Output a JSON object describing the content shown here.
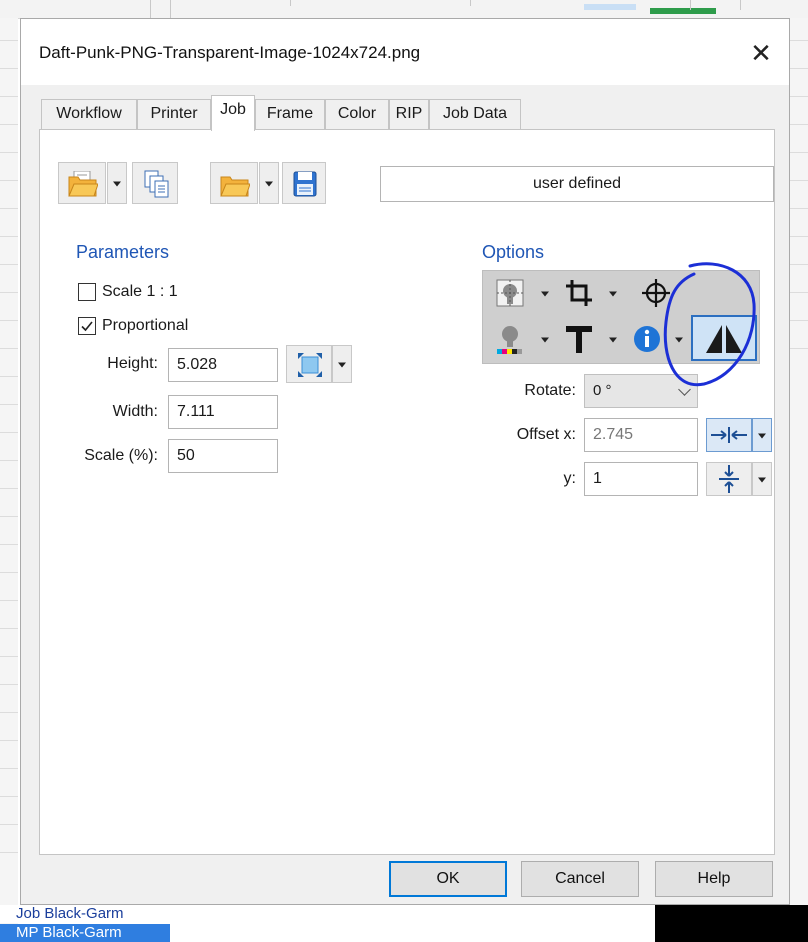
{
  "window": {
    "title": "Daft-Punk-PNG-Transparent-Image-1024x724.png",
    "close_symbol": "✕"
  },
  "tabs": [
    "Workflow",
    "Printer",
    "Job",
    "Frame",
    "Color",
    "RIP",
    "Job Data"
  ],
  "active_tab": "Job",
  "toolbar": {
    "preset_value": "user defined",
    "icons": [
      "open-folder-icon",
      "dropdown-caret",
      "copy-documents-icon",
      "open-folder-icon",
      "dropdown-caret",
      "save-disk-icon"
    ]
  },
  "parameters": {
    "title": "Parameters",
    "scale_1_1": {
      "label": "Scale 1 : 1",
      "checked": false
    },
    "proportional": {
      "label": "Proportional",
      "checked": true
    },
    "height": {
      "label": "Height:",
      "value": "5.028"
    },
    "width": {
      "label": "Width:",
      "value": "7.111"
    },
    "scale": {
      "label": "Scale (%):",
      "value": "50"
    },
    "fit_icon": "fit-to-page-icon"
  },
  "options": {
    "title": "Options",
    "buttons": [
      "tile-print-icon",
      "crop-icon",
      "crosshair-registration-icon",
      "color-bar-icon",
      "text-T-icon",
      "info-icon",
      "mirror-icon"
    ],
    "rotate": {
      "label": "Rotate:",
      "value": "0 °"
    },
    "offset_x": {
      "label": "Offset x:",
      "value": "2.745"
    },
    "offset_y": {
      "label": "y:",
      "value": "1"
    },
    "mirror_active": true
  },
  "footer": {
    "ok": "OK",
    "cancel": "Cancel",
    "help": "Help"
  },
  "background": {
    "row1": "Job Black-Garm",
    "row2": "MP Black-Garm"
  },
  "colors": {
    "accent_blue": "#1f56b5",
    "annotation_circle": "#1c2fd6",
    "selected_row": "#2f7ee0"
  }
}
